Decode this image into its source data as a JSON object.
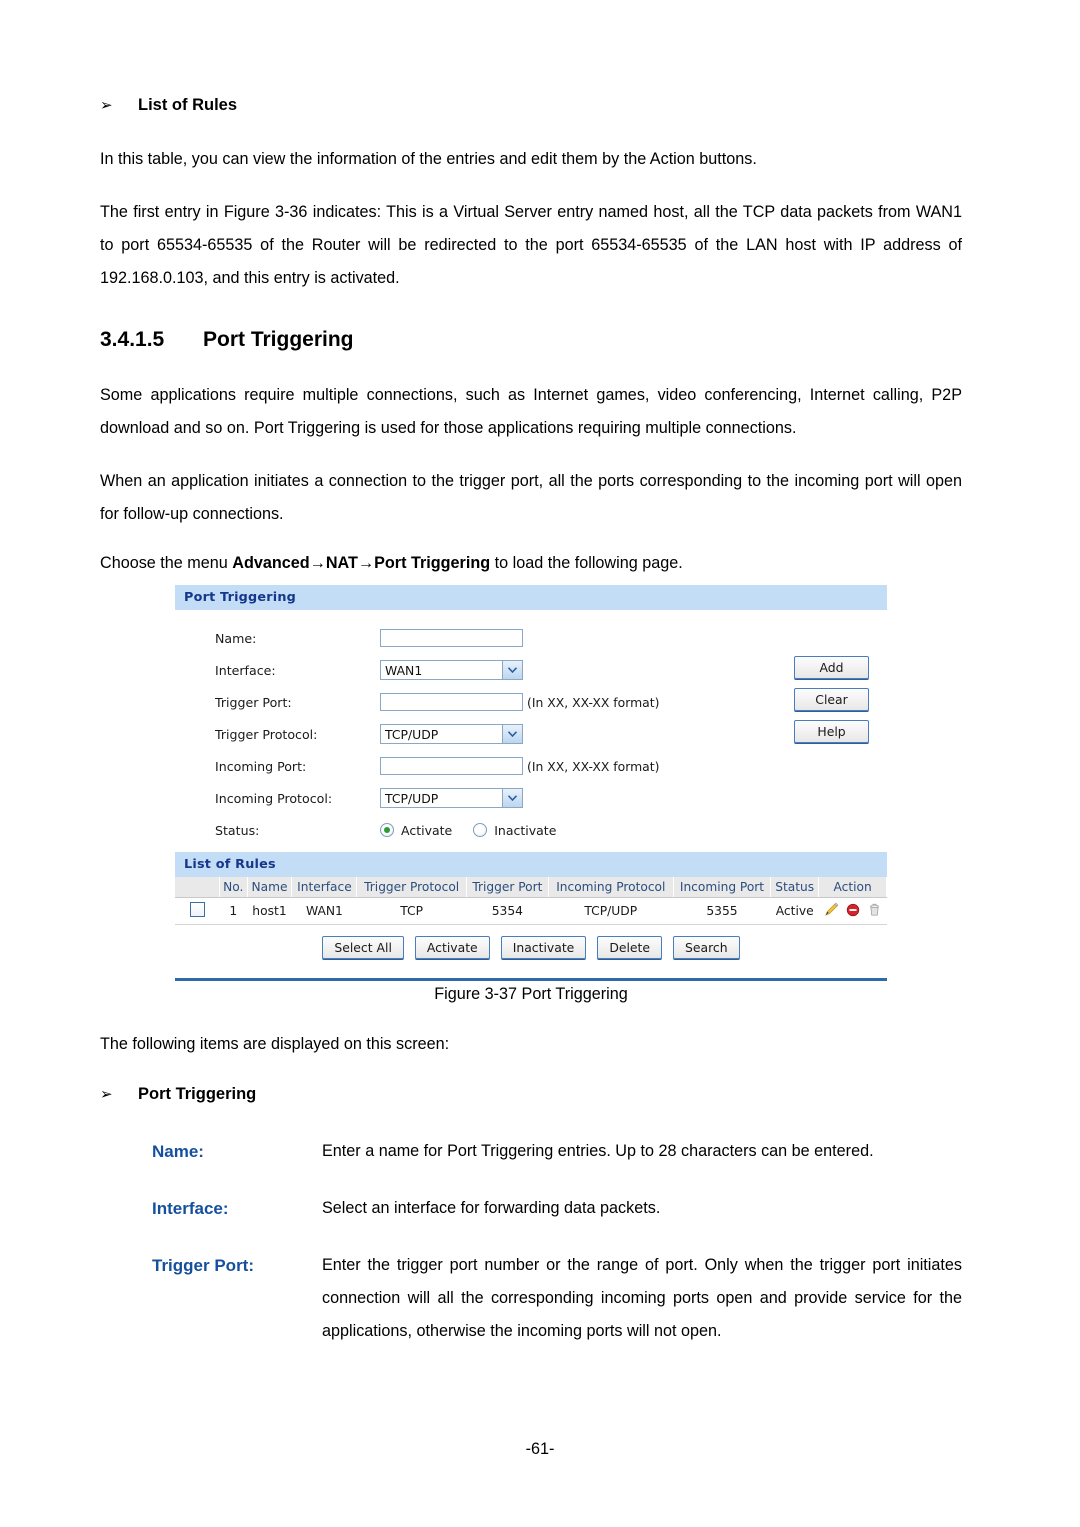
{
  "document": {
    "page_number": "-61-",
    "figure_caption": "Figure 3-37 Port Triggering"
  },
  "list_of_rules_section": {
    "bullet_glyph": "➢",
    "heading": "List of Rules",
    "paragraph_1": "In this table, you can view the information of the entries and edit them by the Action buttons.",
    "paragraph_2": "The first entry in Figure 3-36 indicates: This is a Virtual Server entry named host, all the TCP data packets from WAN1 to port 65534-65535 of the Router will be redirected to the port 65534-65535 of the LAN host with IP address of 192.168.0.103, and this entry is activated."
  },
  "port_triggering_section": {
    "number": "3.4.1.5",
    "title": "Port Triggering",
    "paragraph_1": "Some applications require multiple connections, such as Internet games, video conferencing, Internet calling, P2P download and so on. Port Triggering is used for those applications requiring multiple connections.",
    "paragraph_2": "When an application initiates a connection to the trigger port, all the ports corresponding to the incoming port will open for follow-up connections.",
    "menu_sentence_prefix": "Choose the menu ",
    "menu_path": "Advanced→NAT→Port Triggering",
    "menu_sentence_suffix": " to load the following page."
  },
  "screenshot": {
    "panel_title": "Port Triggering",
    "form": {
      "fields": [
        {
          "label": "Name:",
          "type": "text",
          "value": "",
          "hint": ""
        },
        {
          "label": "Interface:",
          "type": "select",
          "value": "WAN1",
          "hint": ""
        },
        {
          "label": "Trigger Port:",
          "type": "text",
          "value": "",
          "hint": "(In XX, XX-XX format)"
        },
        {
          "label": "Trigger Protocol:",
          "type": "select",
          "value": "TCP/UDP",
          "hint": ""
        },
        {
          "label": "Incoming Port:",
          "type": "text",
          "value": "",
          "hint": "(In XX, XX-XX format)"
        },
        {
          "label": "Incoming Protocol:",
          "type": "select",
          "value": "TCP/UDP",
          "hint": ""
        }
      ],
      "status": {
        "label": "Status:",
        "options": [
          "Activate",
          "Inactivate"
        ],
        "selected": "Activate"
      },
      "side_buttons": [
        "Add",
        "Clear",
        "Help"
      ]
    },
    "list_panel_title": "List of Rules",
    "table": {
      "columns": [
        "",
        "No.",
        "Name",
        "Interface",
        "Trigger Protocol",
        "Trigger Port",
        "Incoming Protocol",
        "Incoming Port",
        "Status",
        "Action"
      ],
      "rows": [
        {
          "no": "1",
          "name": "host1",
          "interface": "WAN1",
          "trigger_protocol": "TCP",
          "trigger_port": "5354",
          "incoming_protocol": "TCP/UDP",
          "incoming_port": "5355",
          "status": "Active",
          "action_icons": [
            "edit-pencil-icon",
            "block-icon",
            "delete-trash-icon"
          ]
        }
      ],
      "buttons": [
        "Select All",
        "Activate",
        "Inactivate",
        "Delete",
        "Search"
      ]
    },
    "colors": {
      "panel_header_bg": "#c3ddf7",
      "panel_header_text": "#15378c",
      "table_header_bg": "#e9e9e9",
      "table_header_text": "#2b4d7e",
      "rule_line": "#2d6aa6",
      "radio_selected": "#2f9a32"
    }
  },
  "items_intro": "The following items are displayed on this screen:",
  "items_heading": "Port Triggering",
  "definitions": [
    {
      "term": "Name:",
      "description": "Enter a name for Port Triggering entries. Up to 28 characters can be entered."
    },
    {
      "term": "Interface:",
      "description": "Select an interface for forwarding data packets."
    },
    {
      "term": "Trigger Port:",
      "description": "Enter the trigger port number or the range of port. Only when the trigger port initiates connection will all the corresponding incoming ports open and provide service for the applications, otherwise the incoming ports will not open."
    }
  ]
}
